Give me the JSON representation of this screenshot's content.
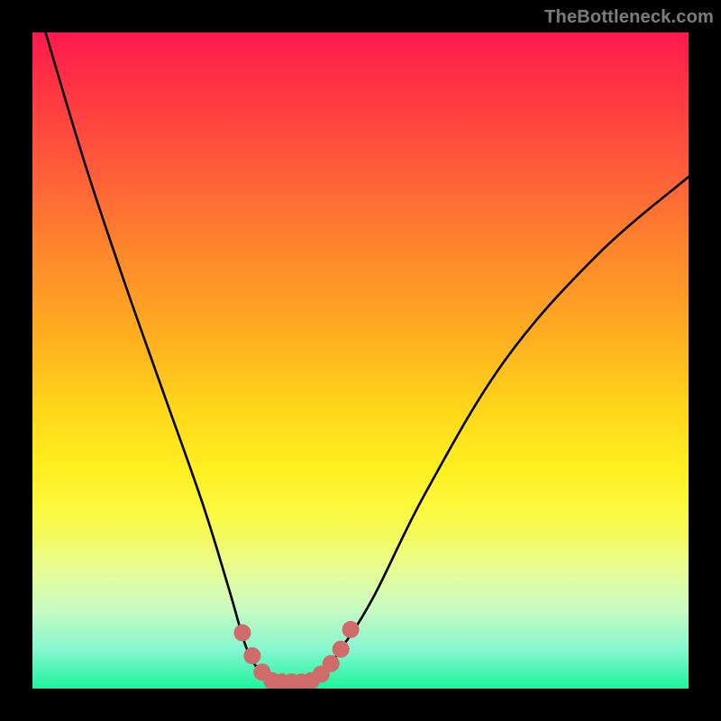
{
  "attribution": {
    "text": "TheBottleneck.com"
  },
  "chart_data": {
    "type": "line",
    "title": "",
    "xlabel": "",
    "ylabel": "",
    "xlim": [
      0,
      1
    ],
    "ylim": [
      0,
      1
    ],
    "series": [
      {
        "name": "curve",
        "x": [
          0.02,
          0.08,
          0.14,
          0.2,
          0.26,
          0.3,
          0.325,
          0.345,
          0.365,
          0.385,
          0.41,
          0.44,
          0.47,
          0.52,
          0.6,
          0.72,
          0.86,
          1.0
        ],
        "y": [
          1.0,
          0.8,
          0.62,
          0.45,
          0.28,
          0.15,
          0.065,
          0.028,
          0.01,
          0.01,
          0.01,
          0.022,
          0.06,
          0.14,
          0.3,
          0.5,
          0.66,
          0.78
        ]
      }
    ],
    "highlight": {
      "name": "base-highlight",
      "color": "#cf6b6a",
      "x": [
        0.32,
        0.335,
        0.35,
        0.365,
        0.38,
        0.395,
        0.41,
        0.425,
        0.44,
        0.455,
        0.47,
        0.485
      ],
      "y": [
        0.085,
        0.05,
        0.025,
        0.012,
        0.01,
        0.01,
        0.01,
        0.012,
        0.022,
        0.038,
        0.06,
        0.09
      ]
    }
  }
}
